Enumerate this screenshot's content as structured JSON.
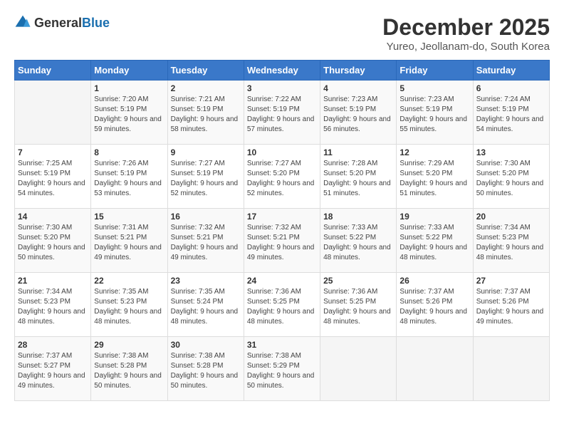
{
  "header": {
    "logo_general": "General",
    "logo_blue": "Blue",
    "month_title": "December 2025",
    "location": "Yureo, Jeollanam-do, South Korea"
  },
  "days_of_week": [
    "Sunday",
    "Monday",
    "Tuesday",
    "Wednesday",
    "Thursday",
    "Friday",
    "Saturday"
  ],
  "weeks": [
    {
      "days": [
        {
          "number": "",
          "sunrise": "",
          "sunset": "",
          "daylight": "",
          "empty": true
        },
        {
          "number": "1",
          "sunrise": "Sunrise: 7:20 AM",
          "sunset": "Sunset: 5:19 PM",
          "daylight": "Daylight: 9 hours and 59 minutes."
        },
        {
          "number": "2",
          "sunrise": "Sunrise: 7:21 AM",
          "sunset": "Sunset: 5:19 PM",
          "daylight": "Daylight: 9 hours and 58 minutes."
        },
        {
          "number": "3",
          "sunrise": "Sunrise: 7:22 AM",
          "sunset": "Sunset: 5:19 PM",
          "daylight": "Daylight: 9 hours and 57 minutes."
        },
        {
          "number": "4",
          "sunrise": "Sunrise: 7:23 AM",
          "sunset": "Sunset: 5:19 PM",
          "daylight": "Daylight: 9 hours and 56 minutes."
        },
        {
          "number": "5",
          "sunrise": "Sunrise: 7:23 AM",
          "sunset": "Sunset: 5:19 PM",
          "daylight": "Daylight: 9 hours and 55 minutes."
        },
        {
          "number": "6",
          "sunrise": "Sunrise: 7:24 AM",
          "sunset": "Sunset: 5:19 PM",
          "daylight": "Daylight: 9 hours and 54 minutes."
        }
      ]
    },
    {
      "days": [
        {
          "number": "7",
          "sunrise": "Sunrise: 7:25 AM",
          "sunset": "Sunset: 5:19 PM",
          "daylight": "Daylight: 9 hours and 54 minutes."
        },
        {
          "number": "8",
          "sunrise": "Sunrise: 7:26 AM",
          "sunset": "Sunset: 5:19 PM",
          "daylight": "Daylight: 9 hours and 53 minutes."
        },
        {
          "number": "9",
          "sunrise": "Sunrise: 7:27 AM",
          "sunset": "Sunset: 5:19 PM",
          "daylight": "Daylight: 9 hours and 52 minutes."
        },
        {
          "number": "10",
          "sunrise": "Sunrise: 7:27 AM",
          "sunset": "Sunset: 5:20 PM",
          "daylight": "Daylight: 9 hours and 52 minutes."
        },
        {
          "number": "11",
          "sunrise": "Sunrise: 7:28 AM",
          "sunset": "Sunset: 5:20 PM",
          "daylight": "Daylight: 9 hours and 51 minutes."
        },
        {
          "number": "12",
          "sunrise": "Sunrise: 7:29 AM",
          "sunset": "Sunset: 5:20 PM",
          "daylight": "Daylight: 9 hours and 51 minutes."
        },
        {
          "number": "13",
          "sunrise": "Sunrise: 7:30 AM",
          "sunset": "Sunset: 5:20 PM",
          "daylight": "Daylight: 9 hours and 50 minutes."
        }
      ]
    },
    {
      "days": [
        {
          "number": "14",
          "sunrise": "Sunrise: 7:30 AM",
          "sunset": "Sunset: 5:20 PM",
          "daylight": "Daylight: 9 hours and 50 minutes."
        },
        {
          "number": "15",
          "sunrise": "Sunrise: 7:31 AM",
          "sunset": "Sunset: 5:21 PM",
          "daylight": "Daylight: 9 hours and 49 minutes."
        },
        {
          "number": "16",
          "sunrise": "Sunrise: 7:32 AM",
          "sunset": "Sunset: 5:21 PM",
          "daylight": "Daylight: 9 hours and 49 minutes."
        },
        {
          "number": "17",
          "sunrise": "Sunrise: 7:32 AM",
          "sunset": "Sunset: 5:21 PM",
          "daylight": "Daylight: 9 hours and 49 minutes."
        },
        {
          "number": "18",
          "sunrise": "Sunrise: 7:33 AM",
          "sunset": "Sunset: 5:22 PM",
          "daylight": "Daylight: 9 hours and 48 minutes."
        },
        {
          "number": "19",
          "sunrise": "Sunrise: 7:33 AM",
          "sunset": "Sunset: 5:22 PM",
          "daylight": "Daylight: 9 hours and 48 minutes."
        },
        {
          "number": "20",
          "sunrise": "Sunrise: 7:34 AM",
          "sunset": "Sunset: 5:23 PM",
          "daylight": "Daylight: 9 hours and 48 minutes."
        }
      ]
    },
    {
      "days": [
        {
          "number": "21",
          "sunrise": "Sunrise: 7:34 AM",
          "sunset": "Sunset: 5:23 PM",
          "daylight": "Daylight: 9 hours and 48 minutes."
        },
        {
          "number": "22",
          "sunrise": "Sunrise: 7:35 AM",
          "sunset": "Sunset: 5:23 PM",
          "daylight": "Daylight: 9 hours and 48 minutes."
        },
        {
          "number": "23",
          "sunrise": "Sunrise: 7:35 AM",
          "sunset": "Sunset: 5:24 PM",
          "daylight": "Daylight: 9 hours and 48 minutes."
        },
        {
          "number": "24",
          "sunrise": "Sunrise: 7:36 AM",
          "sunset": "Sunset: 5:25 PM",
          "daylight": "Daylight: 9 hours and 48 minutes."
        },
        {
          "number": "25",
          "sunrise": "Sunrise: 7:36 AM",
          "sunset": "Sunset: 5:25 PM",
          "daylight": "Daylight: 9 hours and 48 minutes."
        },
        {
          "number": "26",
          "sunrise": "Sunrise: 7:37 AM",
          "sunset": "Sunset: 5:26 PM",
          "daylight": "Daylight: 9 hours and 48 minutes."
        },
        {
          "number": "27",
          "sunrise": "Sunrise: 7:37 AM",
          "sunset": "Sunset: 5:26 PM",
          "daylight": "Daylight: 9 hours and 49 minutes."
        }
      ]
    },
    {
      "days": [
        {
          "number": "28",
          "sunrise": "Sunrise: 7:37 AM",
          "sunset": "Sunset: 5:27 PM",
          "daylight": "Daylight: 9 hours and 49 minutes."
        },
        {
          "number": "29",
          "sunrise": "Sunrise: 7:38 AM",
          "sunset": "Sunset: 5:28 PM",
          "daylight": "Daylight: 9 hours and 50 minutes."
        },
        {
          "number": "30",
          "sunrise": "Sunrise: 7:38 AM",
          "sunset": "Sunset: 5:28 PM",
          "daylight": "Daylight: 9 hours and 50 minutes."
        },
        {
          "number": "31",
          "sunrise": "Sunrise: 7:38 AM",
          "sunset": "Sunset: 5:29 PM",
          "daylight": "Daylight: 9 hours and 50 minutes."
        },
        {
          "number": "",
          "sunrise": "",
          "sunset": "",
          "daylight": "",
          "empty": true
        },
        {
          "number": "",
          "sunrise": "",
          "sunset": "",
          "daylight": "",
          "empty": true
        },
        {
          "number": "",
          "sunrise": "",
          "sunset": "",
          "daylight": "",
          "empty": true
        }
      ]
    }
  ]
}
